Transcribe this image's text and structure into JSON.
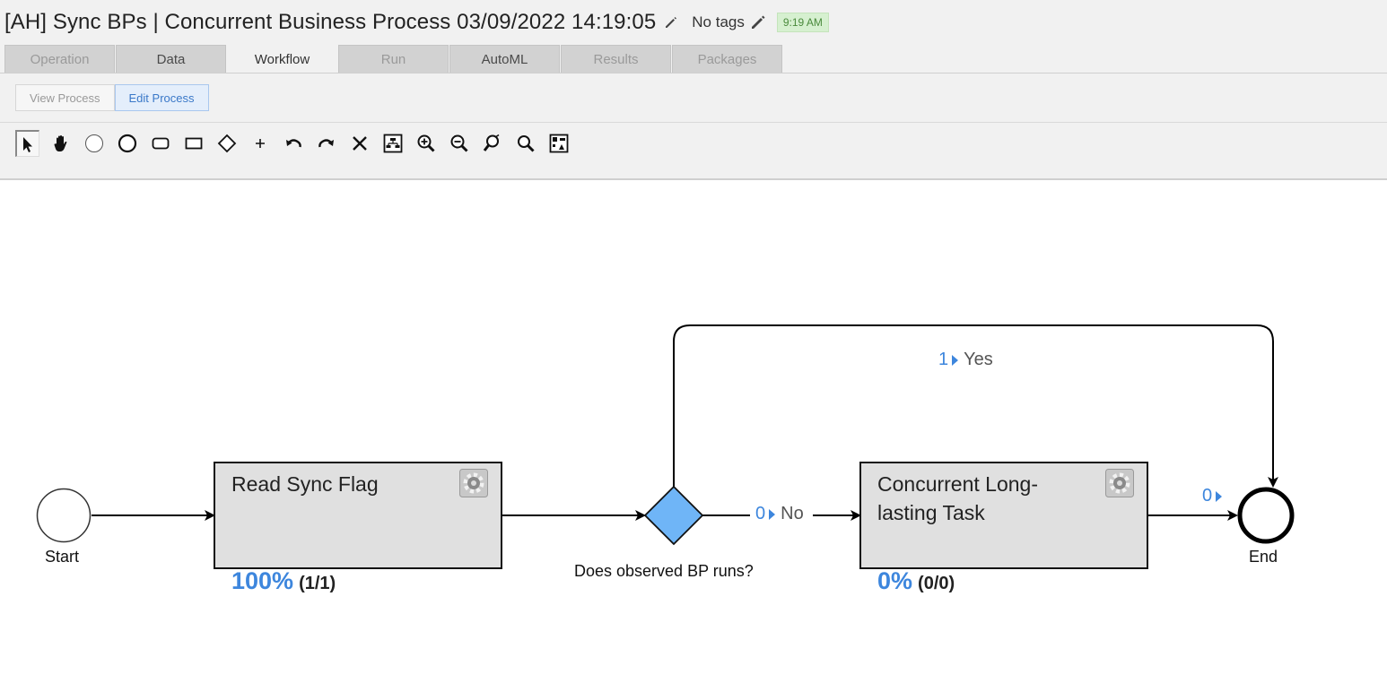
{
  "header": {
    "title": "[AH] Sync BPs | Concurrent Business Process 03/09/2022 14:19:05",
    "tags_label": "No tags",
    "time_badge": "9:19 AM"
  },
  "tabs": [
    {
      "label": "Operation"
    },
    {
      "label": "Data"
    },
    {
      "label": "Workflow"
    },
    {
      "label": "Run"
    },
    {
      "label": "AutoML"
    },
    {
      "label": "Results"
    },
    {
      "label": "Packages"
    }
  ],
  "mode": {
    "view_label": "View Process",
    "edit_label": "Edit Process"
  },
  "toolbar": [
    {
      "icon": "pointer-icon"
    },
    {
      "icon": "hand-icon"
    },
    {
      "icon": "start-event-icon"
    },
    {
      "icon": "end-event-icon"
    },
    {
      "icon": "rounded-task-icon"
    },
    {
      "icon": "rectangle-icon"
    },
    {
      "icon": "gateway-diamond-icon"
    },
    {
      "icon": "plus-icon"
    },
    {
      "icon": "undo-icon"
    },
    {
      "icon": "redo-icon"
    },
    {
      "icon": "delete-icon"
    },
    {
      "icon": "auto-layout-icon"
    },
    {
      "icon": "zoom-in-icon"
    },
    {
      "icon": "zoom-out-icon"
    },
    {
      "icon": "zoom-reset-icon"
    },
    {
      "icon": "zoom-fit-icon"
    },
    {
      "icon": "overview-icon"
    }
  ],
  "process": {
    "start_label": "Start",
    "end_label": "End",
    "gateway_label": "Does observed BP runs?",
    "task1": {
      "title": "Read Sync Flag",
      "percent": "100%",
      "fraction": "(1/1)"
    },
    "task2": {
      "title": "Concurrent Long-lasting Task",
      "percent": "0%",
      "fraction": "(0/0)"
    },
    "flow_yes": {
      "count": "1",
      "label": "Yes"
    },
    "flow_no": {
      "count": "0",
      "label": "No"
    },
    "flow_end": {
      "count": "0"
    }
  },
  "colors": {
    "accent": "#3d86dd",
    "gateway_fill": "#6fb5f7",
    "task_fill": "#e0e0e0"
  }
}
